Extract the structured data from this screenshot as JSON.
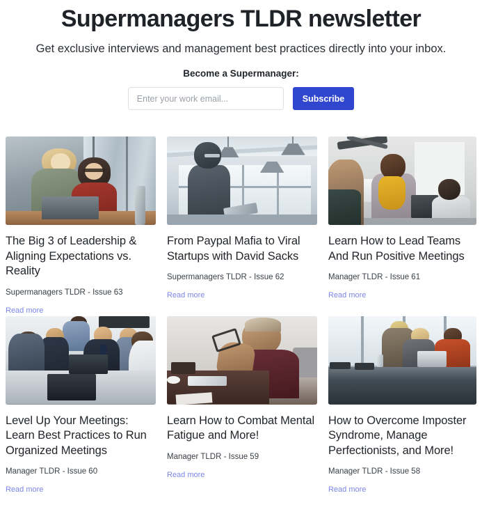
{
  "header": {
    "title": "Supermanagers TLDR newsletter",
    "subtitle": "Get exclusive interviews and management best practices directly into your inbox.",
    "cta_label": "Become a Supermanager:"
  },
  "signup": {
    "email_placeholder": "Enter your work email...",
    "email_value": "",
    "subscribe_label": "Subscribe",
    "button_color": "#3046cf"
  },
  "colors": {
    "accent_blue": "#3046cf",
    "link": "#7b86e8",
    "title_text": "#1f2328",
    "body_text": "#22262b"
  },
  "cards": [
    {
      "title": "The Big 3 of Leadership & Aligning Expectations vs. Reality",
      "meta": "Supermanagers TLDR - Issue 63",
      "link_label": "Read more",
      "image_alt": "two-women-at-laptop-in-office"
    },
    {
      "title": "From Paypal Mafia to Viral Startups with David Sacks",
      "meta": "Supermanagers TLDR - Issue 62",
      "link_label": "Read more",
      "image_alt": "man-with-tablet-backlit-office-windows"
    },
    {
      "title": "Learn How to Lead Teams And Run Positive Meetings",
      "meta": "Manager TLDR - Issue 61",
      "link_label": "Read more",
      "image_alt": "woman-with-yellow-scarf-leading-meeting"
    },
    {
      "title": "Level Up Your Meetings: Learn Best Practices to Run Organized Meetings",
      "meta": "Manager TLDR - Issue 60",
      "link_label": "Read more",
      "image_alt": "team-meeting-around-conference-table"
    },
    {
      "title": "Learn How to Combat Mental Fatigue and More!",
      "meta": "Manager TLDR - Issue 59",
      "link_label": "Read more",
      "image_alt": "tired-man-rubbing-eyes-holding-glasses"
    },
    {
      "title": "How to Overcome Imposter Syndrome, Manage Perfectionists, and More!",
      "meta": "Manager TLDR - Issue 58",
      "link_label": "Read more",
      "image_alt": "three-colleagues-at-conference-table-with-laptop"
    }
  ]
}
